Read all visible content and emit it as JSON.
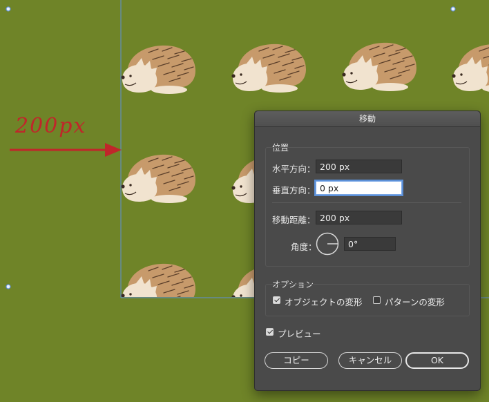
{
  "canvas": {
    "annotation": "200px",
    "background_color": "#6f8428",
    "arrow_color": "#c0262a",
    "guide_color": "#5f8fd8"
  },
  "dialog": {
    "title": "移動",
    "position_group": {
      "label": "位置",
      "horizontal_label": "水平方向：",
      "horizontal_value": "200 px",
      "vertical_label": "垂直方向：",
      "vertical_value": "0 px",
      "distance_label": "移動距離：",
      "distance_value": "200 px",
      "angle_label": "角度：",
      "angle_value": "0°"
    },
    "options_group": {
      "label": "オプション",
      "transform_objects": {
        "label": "オブジェクトの変形",
        "checked": true
      },
      "transform_patterns": {
        "label": "パターンの変形",
        "checked": false
      }
    },
    "preview": {
      "label": "プレビュー",
      "checked": true
    },
    "buttons": {
      "copy": "コピー",
      "cancel": "キャンセル",
      "ok": "OK"
    }
  }
}
